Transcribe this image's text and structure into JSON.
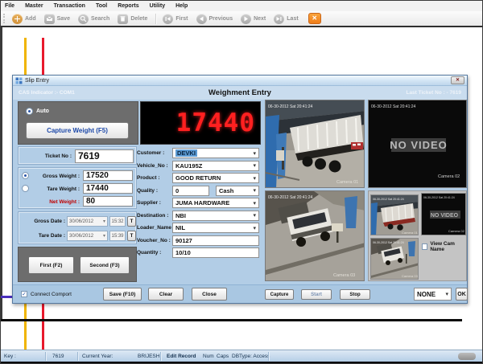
{
  "menu": {
    "items": [
      "File",
      "Master",
      "Transaction",
      "Tool",
      "Reports",
      "Utility",
      "Help"
    ]
  },
  "toolbar": {
    "add": "Add",
    "save": "Save",
    "search": "Search",
    "delete": "Delete",
    "first": "First",
    "previous": "Previous",
    "next": "Next",
    "last": "Last"
  },
  "dialog": {
    "title": "Slip Entry",
    "header": {
      "left": "CAS Indicator :- COM1",
      "center": "Weighment Entry",
      "right": "Last Ticket No : - 7619"
    },
    "capture_panel": {
      "auto": "Auto",
      "capture_button": "Capture Weight (F5)",
      "weight_display": "17440"
    },
    "left_panel": {
      "ticket_label": "Ticket No :",
      "ticket_value": "7619",
      "gross_label": "Gross Weight :",
      "gross_value": "17520",
      "tare_label": "Tare Weight :",
      "tare_value": "17440",
      "net_label": "Net Weight :",
      "net_value": "80",
      "gross_date_label": "Gross Date :",
      "gross_date": "30/06/2012",
      "gross_time": "15:32",
      "tare_date_label": "Tare Date :",
      "tare_date": "30/06/2012",
      "tare_time": "15:39",
      "t_button": "T",
      "first_button": "First  (F2)",
      "second_button": "Second (F3)"
    },
    "form": {
      "customer_label": "Customer :",
      "customer": "DEVKI",
      "vehicle_label": "Vehicle_No :",
      "vehicle": "KAU195Z",
      "product_label": "Product :",
      "product": "GOOD RETURN",
      "quality_label": "Quality :",
      "quality": "0",
      "pay_mode": "Cash",
      "supplier_label": "Supplier :",
      "supplier": "JUMA HARDWARE",
      "destination_label": "Destination :",
      "destination": "NBI",
      "loader_label": "Loader_Name :",
      "loader": "NIL",
      "voucher_label": "Voucher_No :",
      "voucher": "90127",
      "quantity_label": "Quantity :",
      "quantity": "10/10"
    },
    "cameras": {
      "timestamp": "06-30-2012 Sat 20:41:24",
      "cam1_label": "Camera 01",
      "cam2_label": "Camera 02",
      "cam3_label": "Camera 03",
      "no_video": "NO VIDEO",
      "view_cam_name": "View Cam Name"
    },
    "footer": {
      "connect_comport": "Connect Comport",
      "save": "Save (F10)",
      "clear": "Clear",
      "close": "Close",
      "capture": "Capture",
      "start": "Start",
      "stop": "Stop",
      "camera_select": "NONE",
      "ok": "OK"
    }
  },
  "statusbar": {
    "key_label": "Key :",
    "ticket": "7619",
    "year_label": "Current Year:",
    "user": "BRIJESH",
    "mode": "Edit Record",
    "num": "Num",
    "caps": "Caps",
    "dbtype": "DBType: Access"
  }
}
